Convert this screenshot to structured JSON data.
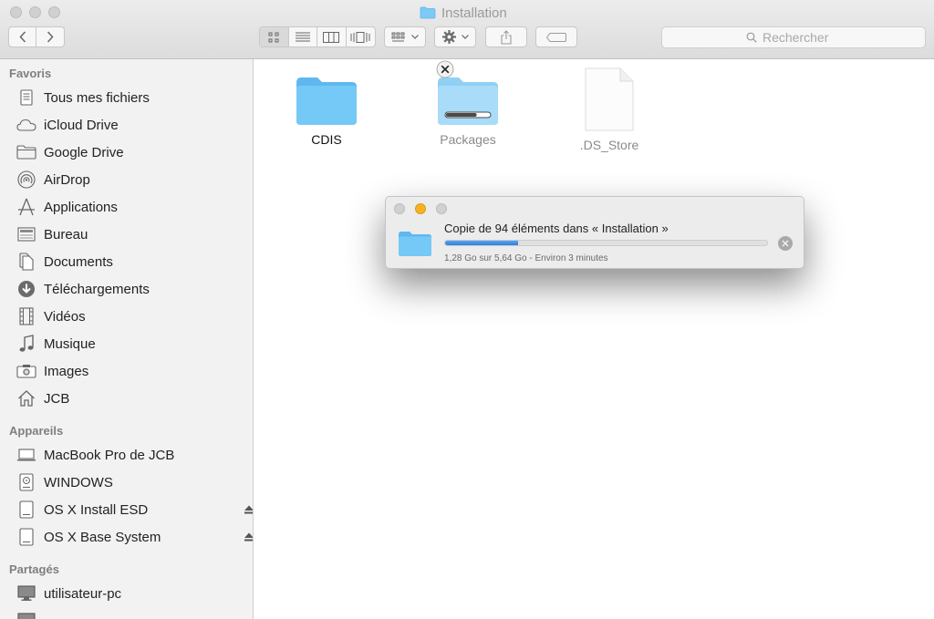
{
  "window": {
    "title": "Installation"
  },
  "toolbar": {
    "back_icon": "chevron-left-icon",
    "forward_icon": "chevron-right-icon",
    "view_modes": [
      "icon-view",
      "list-view",
      "column-view",
      "cover-flow-view"
    ],
    "active_view": "icon-view",
    "arrange_icon": "arrange-grid-icon",
    "action_icon": "gear-icon",
    "share_icon": "share-icon",
    "tag_icon": "tag-icon",
    "search_placeholder": "Rechercher"
  },
  "sidebar": {
    "favorites_header": "Favoris",
    "favorites": [
      {
        "label": "Tous mes fichiers",
        "icon": "all-files-icon"
      },
      {
        "label": "iCloud Drive",
        "icon": "cloud-icon"
      },
      {
        "label": "Google Drive",
        "icon": "folder-icon"
      },
      {
        "label": "AirDrop",
        "icon": "airdrop-icon"
      },
      {
        "label": "Applications",
        "icon": "applications-icon"
      },
      {
        "label": "Bureau",
        "icon": "desktop-icon"
      },
      {
        "label": "Documents",
        "icon": "documents-icon"
      },
      {
        "label": "Téléchargements",
        "icon": "downloads-icon"
      },
      {
        "label": "Vidéos",
        "icon": "film-icon"
      },
      {
        "label": "Musique",
        "icon": "music-note-icon"
      },
      {
        "label": "Images",
        "icon": "camera-icon"
      },
      {
        "label": "JCB",
        "icon": "home-icon"
      }
    ],
    "devices_header": "Appareils",
    "devices": [
      {
        "label": "MacBook Pro de JCB",
        "icon": "laptop-icon"
      },
      {
        "label": "WINDOWS",
        "icon": "disk-icon"
      },
      {
        "label": "OS X Install ESD",
        "icon": "drive-icon",
        "ejectable": true
      },
      {
        "label": "OS X Base System",
        "icon": "drive-icon",
        "ejectable": true
      }
    ],
    "shared_header": "Partagés",
    "shared": [
      {
        "label": "utilisateur-pc",
        "icon": "monitor-icon"
      }
    ]
  },
  "files": [
    {
      "name": "CDIS",
      "type": "folder"
    },
    {
      "name": "Packages",
      "type": "folder-copying",
      "progress": 0.7
    },
    {
      "name": ".DS_Store",
      "type": "document"
    }
  ],
  "copy_dialog": {
    "title": "Copie de 94 éléments dans « Installation »",
    "status": "1,28 Go sur 5,64 Go - Environ 3 minutes",
    "progress_percent": 22.7,
    "accent_color": "#3d8fe6"
  },
  "colors": {
    "folder_blue": "#6cc3f4",
    "sidebar_bg": "#f2f2f2",
    "traffic_minimize": "#f5b324"
  }
}
